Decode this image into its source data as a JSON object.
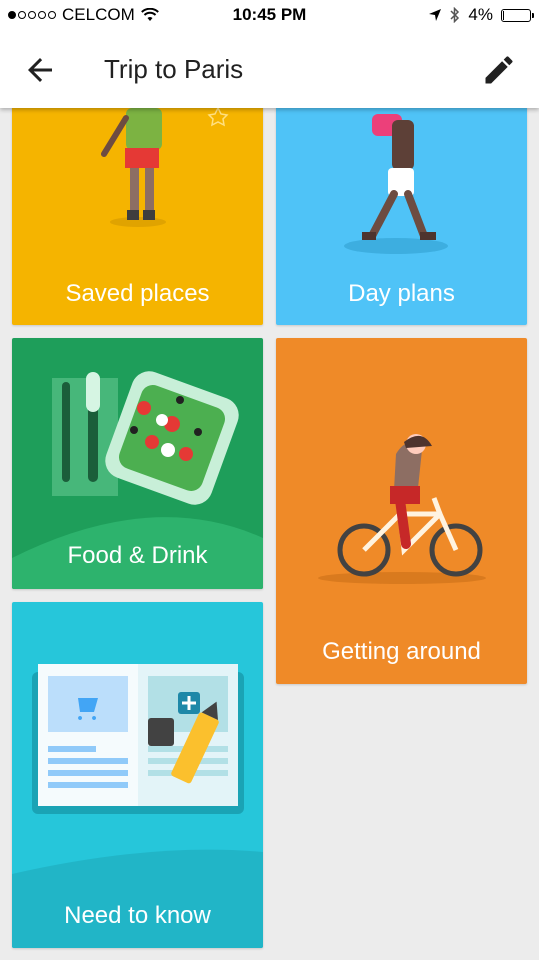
{
  "status_bar": {
    "carrier": "CELCOM",
    "time": "10:45 PM",
    "battery_percent": "4%",
    "signal_bars_filled": 1,
    "signal_bars_total": 5,
    "battery_level": 0.04
  },
  "app_bar": {
    "title": "Trip to Paris",
    "back_icon": "arrow-left-icon",
    "edit_icon": "pencil-icon"
  },
  "tiles": [
    {
      "label": "Saved places",
      "color": "#F5B400"
    },
    {
      "label": "Day plans",
      "color": "#4FC3F7"
    },
    {
      "label": "Food & Drink",
      "color": "#1E9E5A"
    },
    {
      "label": "Getting around",
      "color": "#EF8A28"
    },
    {
      "label": "Need to know",
      "color": "#26C6DA"
    }
  ]
}
